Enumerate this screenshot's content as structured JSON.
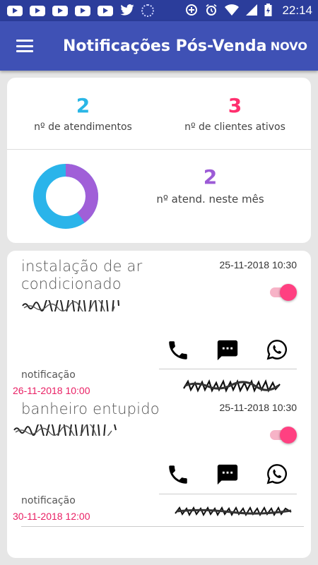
{
  "status_bar": {
    "time": "22:14",
    "left_icons": [
      "youtube-icon",
      "youtube-icon",
      "youtube-icon",
      "youtube-icon",
      "youtube-icon",
      "twitter-icon",
      "sync-icon"
    ],
    "right_icons": [
      "data-saver-icon",
      "alarm-icon",
      "wifi-icon",
      "signal-icon",
      "battery-charging-icon"
    ]
  },
  "app_bar": {
    "title": "Notificações Pós-Venda",
    "new_label": "NOVO",
    "color": "#3f51b5"
  },
  "summary": {
    "atendimentos": {
      "value": "2",
      "label": "nº de atendimentos",
      "color": "#29b6e6"
    },
    "clientes": {
      "value": "3",
      "label": "nº de clientes ativos",
      "color": "#ff2f6e"
    },
    "mes": {
      "value": "2",
      "label": "nº atend. neste mês",
      "color": "#9c5bd6"
    },
    "donut": {
      "purple_fraction": 0.4,
      "purple": "#a05fd8",
      "blue": "#2ab4ea"
    }
  },
  "notifications": [
    {
      "title_line1": "instalação de ar",
      "title_line2": "condicionado",
      "created": "25-11-2018 10:30",
      "enabled": true,
      "notif_label": "notificação",
      "notif_date": "26-11-2018 10:00"
    },
    {
      "title_line1": "banheiro entupido",
      "title_line2": "",
      "created": "25-11-2018 10:30",
      "enabled": true,
      "notif_label": "notificação",
      "notif_date": "30-11-2018 12:00"
    }
  ]
}
